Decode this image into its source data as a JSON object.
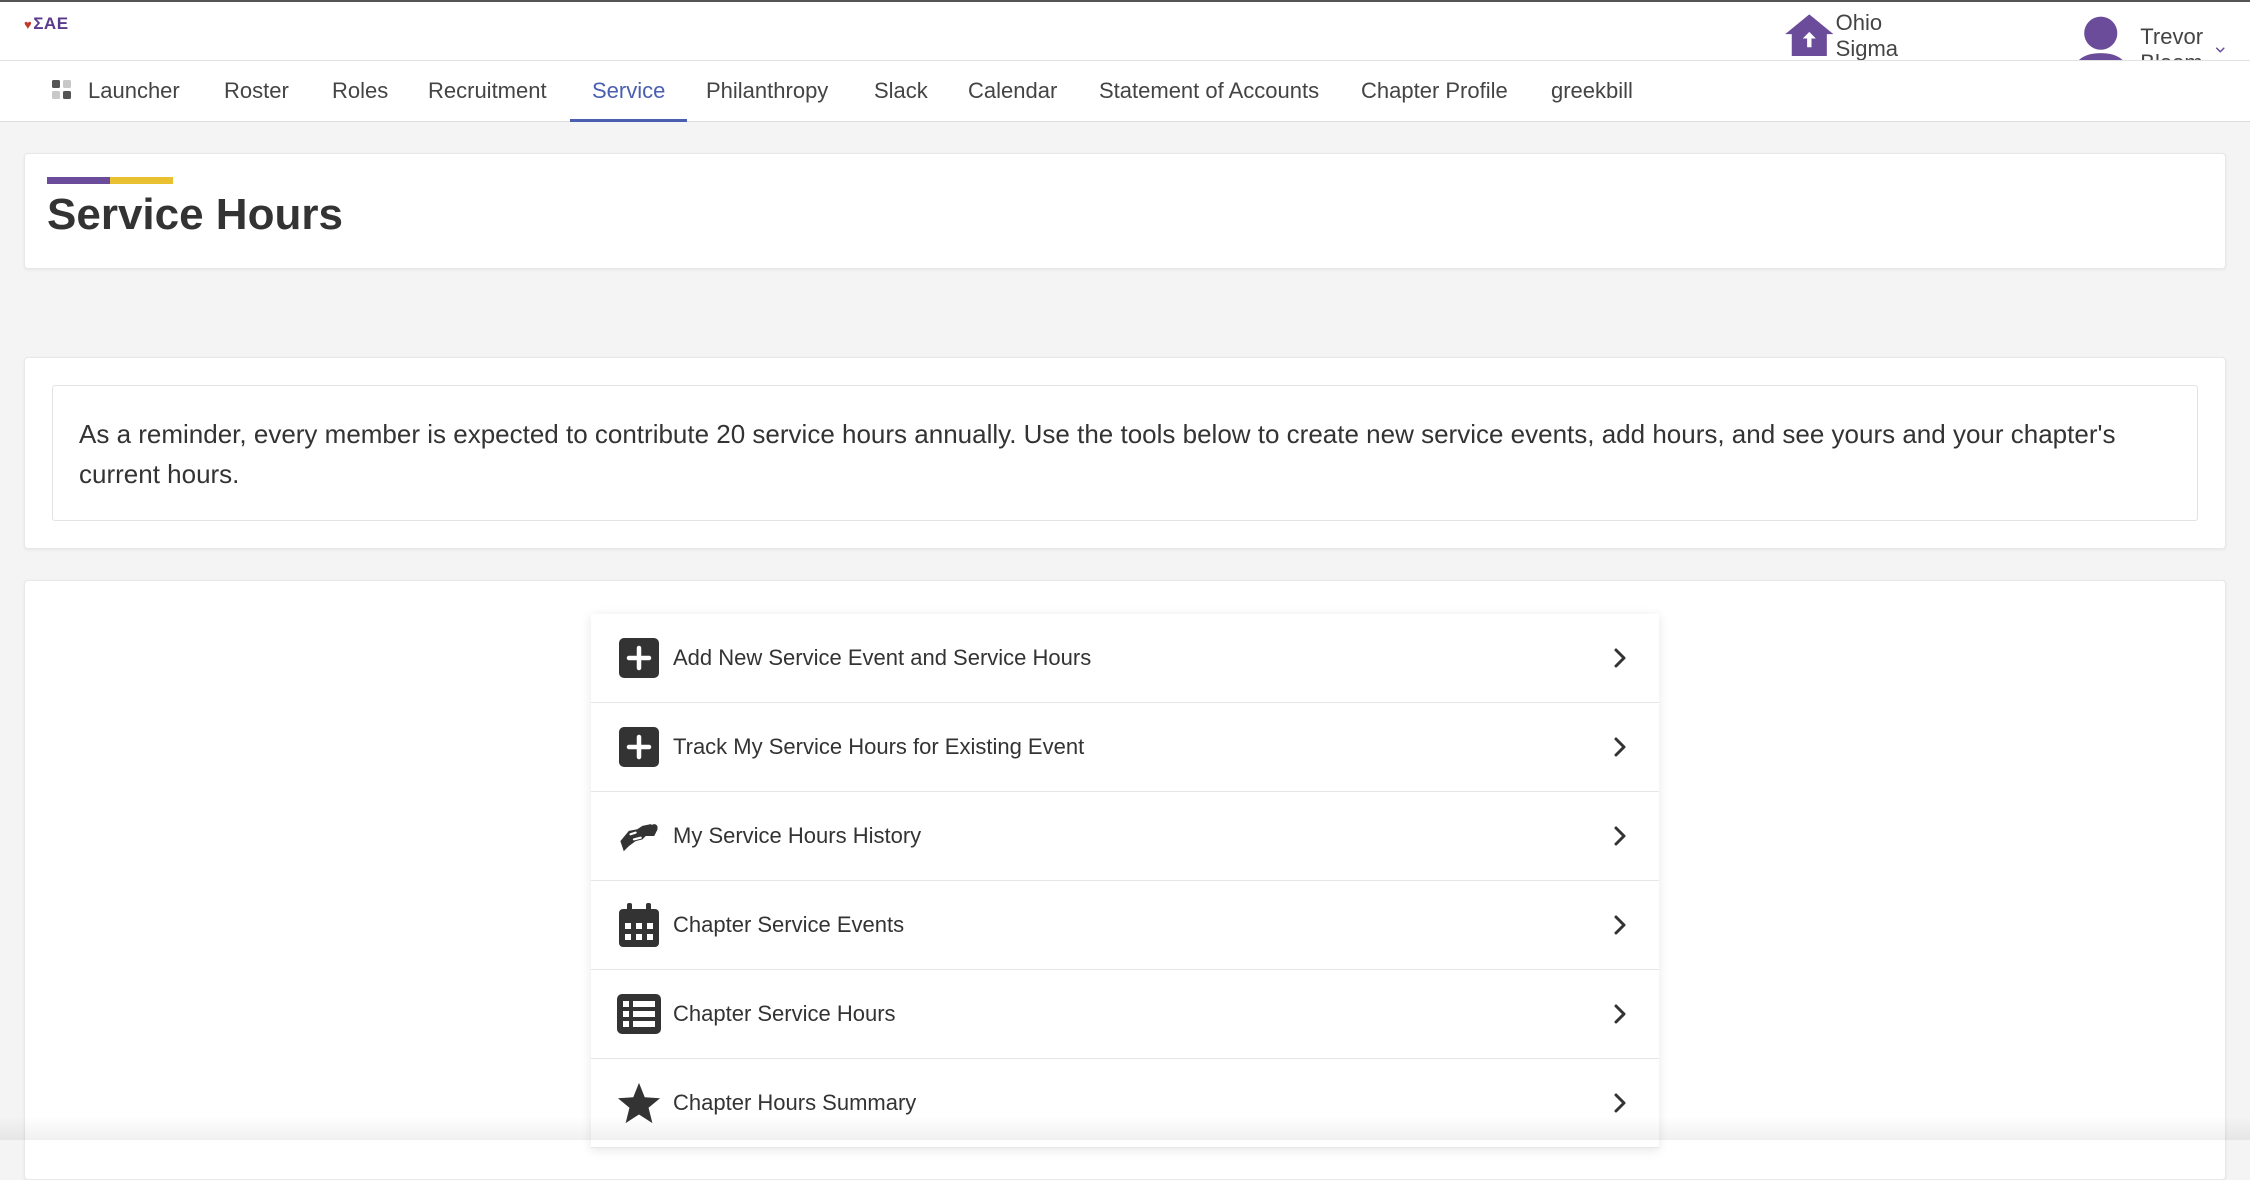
{
  "brand": {
    "logo_text": "ΣΑΕ",
    "accent_purple": "#6b4c9a",
    "accent_gold": "#e8c030",
    "active_blue": "#4a5fb0"
  },
  "header": {
    "chapter_icon": "house-icon",
    "chapter_name": "Ohio Sigma",
    "chat_icon": "chat-bubble-icon",
    "user_icon": "user-icon",
    "user_name": "Trevor Bloom",
    "user_menu_icon": "chevron-down-icon"
  },
  "nav": {
    "items": [
      {
        "label": "Launcher",
        "icon": "grid-icon"
      },
      {
        "label": "Roster"
      },
      {
        "label": "Roles"
      },
      {
        "label": "Recruitment"
      },
      {
        "label": "Service",
        "active": true
      },
      {
        "label": "Philanthropy"
      },
      {
        "label": "Slack"
      },
      {
        "label": "Calendar"
      },
      {
        "label": "Statement of Accounts"
      },
      {
        "label": "Chapter Profile"
      },
      {
        "label": "greekbill"
      }
    ]
  },
  "page": {
    "title": "Service Hours",
    "notice": "As a reminder, every member is expected to contribute 20 service hours annually. Use the tools below to create new service events, add hours, and see yours and your chapter's current hours."
  },
  "tools": [
    {
      "label": "Add New Service Event and Service Hours",
      "icon": "plus-square-icon"
    },
    {
      "label": "Track My Service Hours for Existing Event",
      "icon": "plus-square-icon"
    },
    {
      "label": "My Service Hours History",
      "icon": "handshake-icon"
    },
    {
      "label": "Chapter Service Events",
      "icon": "calendar-icon"
    },
    {
      "label": "Chapter Service Hours",
      "icon": "list-icon"
    },
    {
      "label": "Chapter Hours Summary",
      "icon": "star-icon"
    }
  ]
}
